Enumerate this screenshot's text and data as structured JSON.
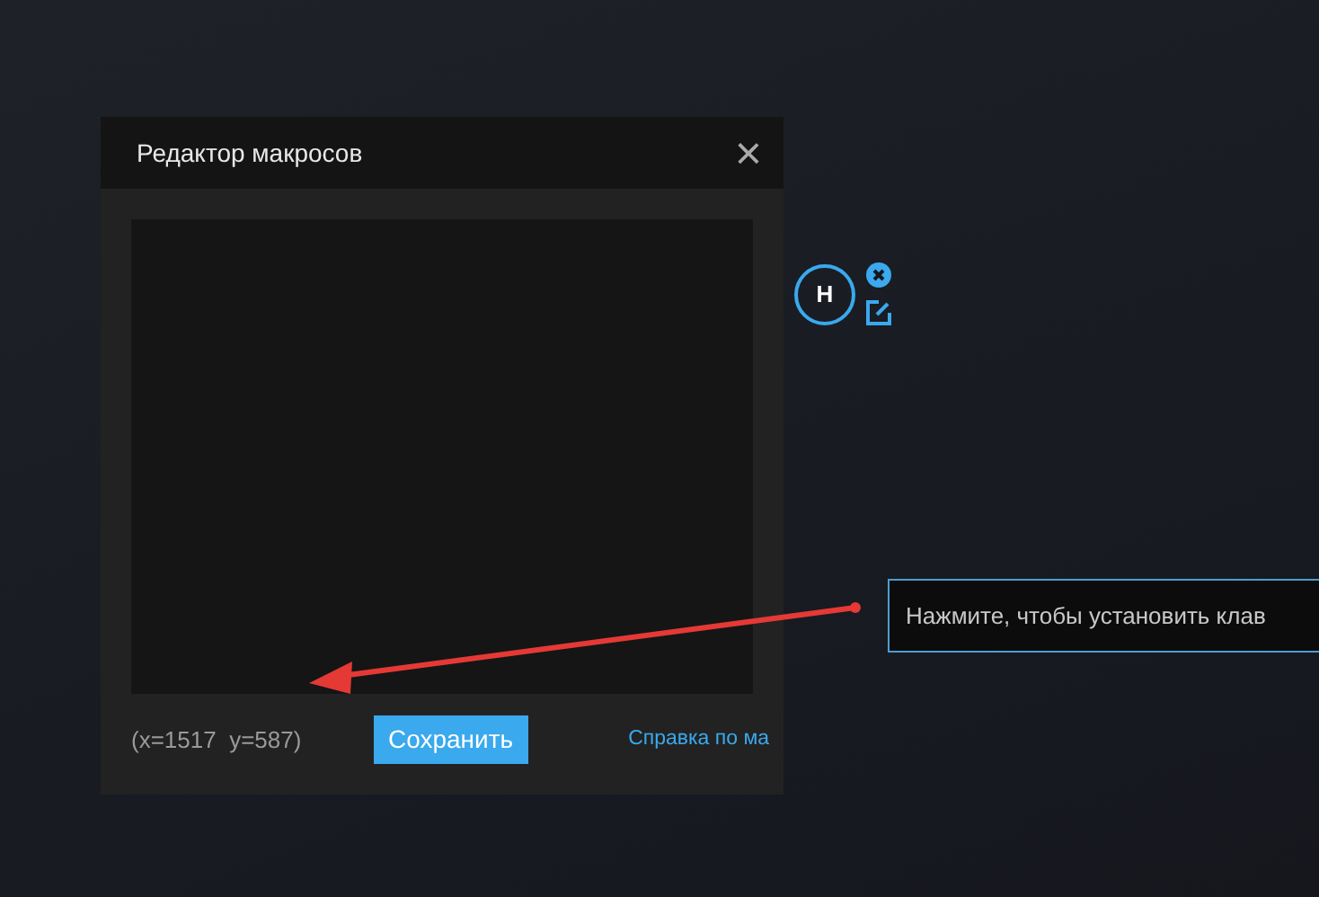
{
  "dialog": {
    "title": "Редактор макросов",
    "close": "×",
    "coordinates": "(x=1517  y=587)",
    "save_button": "Сохранить",
    "help_link": "Справка по ма"
  },
  "key_node": {
    "label": "H"
  },
  "tooltip": {
    "text": "Нажмите, чтобы установить клав"
  }
}
